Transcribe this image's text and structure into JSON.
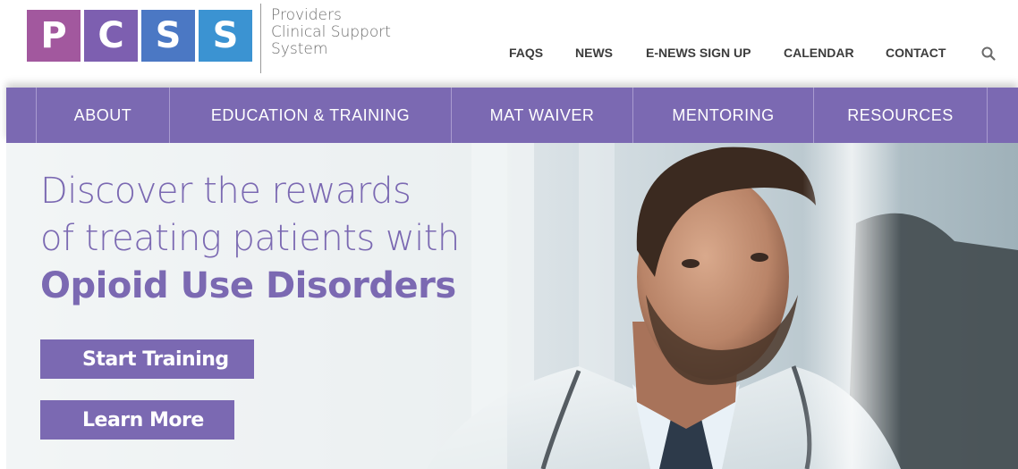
{
  "logo": {
    "letters": [
      "P",
      "C",
      "S",
      "S"
    ],
    "tile_colors": [
      "#a2589e",
      "#7d5fb0",
      "#4b78c4",
      "#3b93d2"
    ],
    "text_lines": [
      "Providers",
      "Clinical Support",
      "System"
    ]
  },
  "utility_nav": {
    "items": [
      "FAQS",
      "NEWS",
      "E-NEWS SIGN UP",
      "CALENDAR",
      "CONTACT"
    ],
    "search_icon": "search-icon"
  },
  "main_nav": {
    "items": [
      "ABOUT",
      "EDUCATION & TRAINING",
      "MAT WAIVER",
      "MENTORING",
      "RESOURCES"
    ]
  },
  "hero": {
    "headline": {
      "line1": "Discover the rewards",
      "line2": "of treating patients with",
      "line3": "Opioid Use Disorders"
    },
    "buttons": {
      "start": "Start Training",
      "learn": "Learn More"
    }
  },
  "colors": {
    "brand_purple": "#7b69b2",
    "nav_text": "#ffffff",
    "utility_text": "#3c3c3c"
  }
}
